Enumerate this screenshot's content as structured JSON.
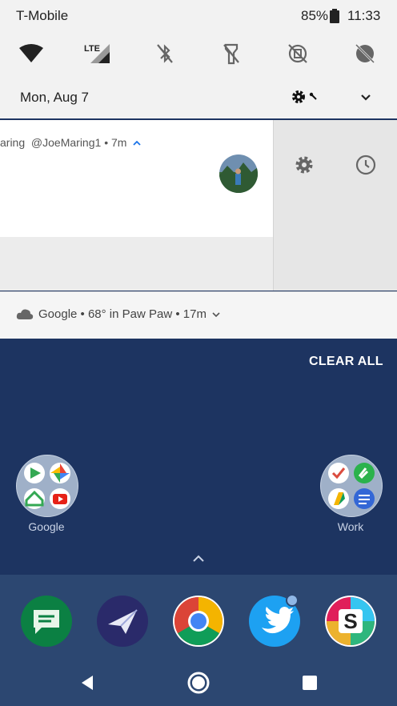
{
  "status_bar": {
    "carrier": "T-Mobile",
    "battery": "85%",
    "time": "11:33"
  },
  "quick_settings": {
    "network_label": "LTE",
    "date": "Mon, Aug 7"
  },
  "notification": {
    "app_name_fragment": "aring",
    "handle": "@JoeMaring1",
    "time": "• 7m",
    "expand_glyph": "^"
  },
  "weather": {
    "text": "Google • 68° in Paw Paw • 17m"
  },
  "home": {
    "clear_all": "CLEAR ALL",
    "folders": [
      {
        "label": "Google"
      },
      {
        "label": "Work"
      }
    ]
  },
  "colors": {
    "wallpaper": "#1d3461",
    "dock": "#2c4771",
    "accent": "#1a73e8"
  }
}
